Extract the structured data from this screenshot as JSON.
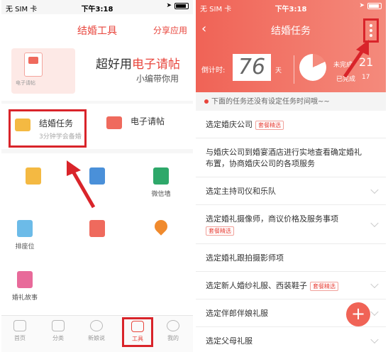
{
  "left": {
    "status": {
      "carrier": "无 SIM 卡",
      "time": "下午3:18"
    },
    "nav": {
      "title": "结婚工具",
      "share": "分享应用"
    },
    "banner": {
      "art_label": "电子请帖",
      "headline_prefix": "超好用",
      "headline_highlight": "电子请帖",
      "subline": "小编带你用"
    },
    "features": [
      {
        "title": "结婚任务",
        "subtitle": "3分钟学会备婚"
      },
      {
        "title": "电子请帖",
        "subtitle": ""
      }
    ],
    "tools": [
      {
        "label": "",
        "icon": "pencil-note-icon",
        "color": "#f4b942"
      },
      {
        "label": "",
        "icon": "checklist-icon",
        "color": "#4a90d9"
      },
      {
        "label": "微信墙",
        "icon": "board-icon",
        "color": "#2ea86a"
      },
      {
        "label": "排座位",
        "icon": "sofa-icon",
        "color": "#6cbbe8"
      },
      {
        "label": "",
        "icon": "calendar-icon",
        "color": "#ef6a5d"
      },
      {
        "label": "",
        "icon": "location-pin-icon",
        "color": "#f08a2d"
      },
      {
        "label": "婚礼故事",
        "icon": "book-icon",
        "color": "#e86a9a"
      }
    ],
    "tabs": [
      {
        "label": "首页",
        "icon": "home-icon"
      },
      {
        "label": "分类",
        "icon": "category-icon"
      },
      {
        "label": "新娘说",
        "icon": "chat-bubble-icon"
      },
      {
        "label": "工具",
        "icon": "toolbox-icon"
      },
      {
        "label": "我的",
        "icon": "profile-icon"
      }
    ]
  },
  "right": {
    "status": {
      "carrier": "无 SIM 卡",
      "time": "下午3:18"
    },
    "nav": {
      "title": "结婚任务",
      "back": "‹"
    },
    "countdown": {
      "label": "倒计时:",
      "days": "76",
      "unit": "天"
    },
    "stats": {
      "pending_label": "未完成",
      "pending_value": "21",
      "done_label": "已完成",
      "done_value": "17"
    },
    "hint": "下面的任务还没有设定任务时间哦~~",
    "tasks": [
      {
        "text": "选定婚庆公司",
        "tag": "套餐精选",
        "chevron": false
      },
      {
        "text": "与婚庆公司到婚宴酒店进行实地查看确定婚礼布置，协商婚庆公司的各项服务",
        "tag": "",
        "chevron": false
      },
      {
        "text": "选定主持司仪和乐队",
        "tag": "",
        "chevron": true
      },
      {
        "text": "选定婚礼摄像师，商议价格及服务事项",
        "tag": "套餐精选",
        "chevron": true
      },
      {
        "text": "选定婚礼跟拍摄影师项",
        "tag": "",
        "chevron": false
      },
      {
        "text": "选定新人婚纱礼服、西装鞋子",
        "tag": "套餐精选",
        "chevron": true
      },
      {
        "text": "选定伴郎伴娘礼服",
        "tag": "",
        "chevron": true
      },
      {
        "text": "选定父母礼服",
        "tag": "",
        "chevron": true
      }
    ],
    "fab": "+"
  },
  "colors": {
    "accent": "#e8453c",
    "highlight_box": "#d9242a",
    "header_gradient_start": "#f06356",
    "header_gradient_end": "#f48a7c"
  }
}
